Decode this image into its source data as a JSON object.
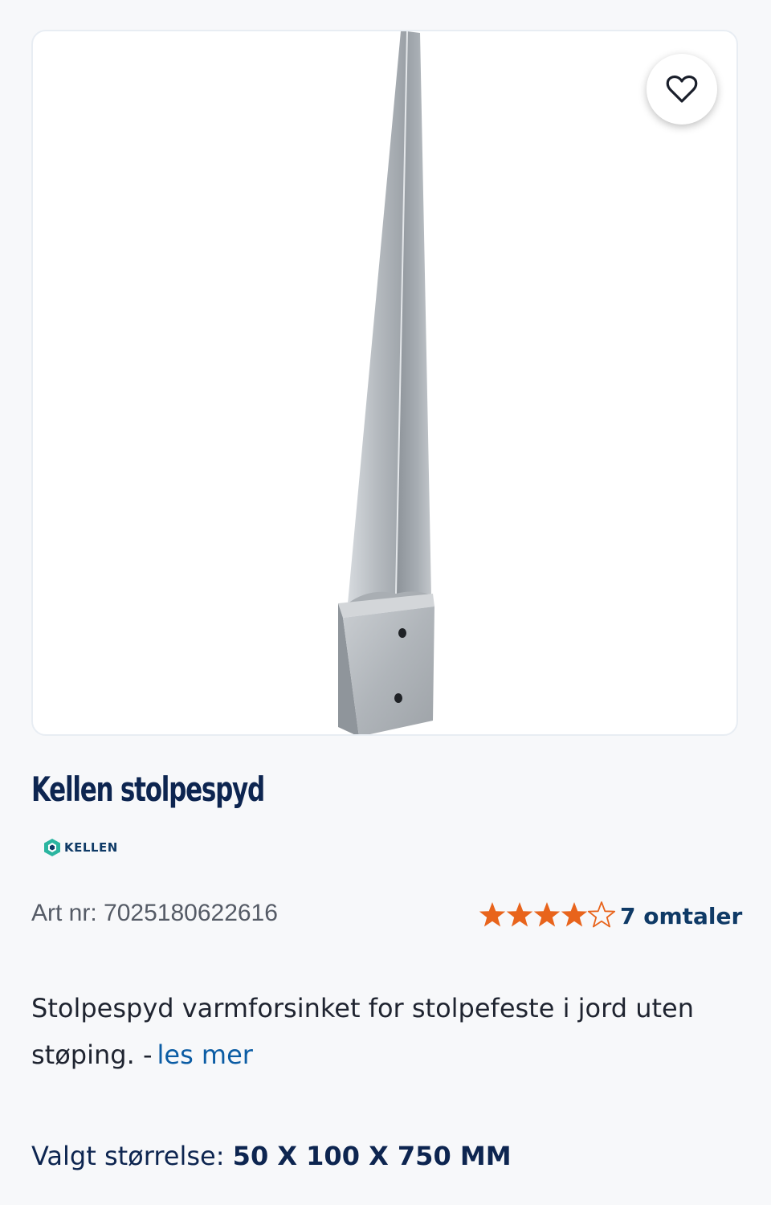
{
  "product": {
    "title": "Kellen stolpespyd",
    "brand": "KELLEN",
    "art_label": "Art nr:",
    "art_number": "7025180622616",
    "rating": 4.5,
    "rating_max": 5,
    "reviews_label": "7 omtaler",
    "description": "Stolpespyd varmforsinket for stolpefeste i jord uten støping. -",
    "read_more": "les mer",
    "size_label": "Valgt størrelse:",
    "size_value": "50 X 100 X 750 MM"
  },
  "icons": {
    "favorite": "heart-outline-icon",
    "brand": "hexagon-logo-icon",
    "star": "star-icon"
  },
  "colors": {
    "title": "#0d2550",
    "star": "#e8641c",
    "link": "#0b5ca4",
    "brand": "#2bb5a0"
  }
}
